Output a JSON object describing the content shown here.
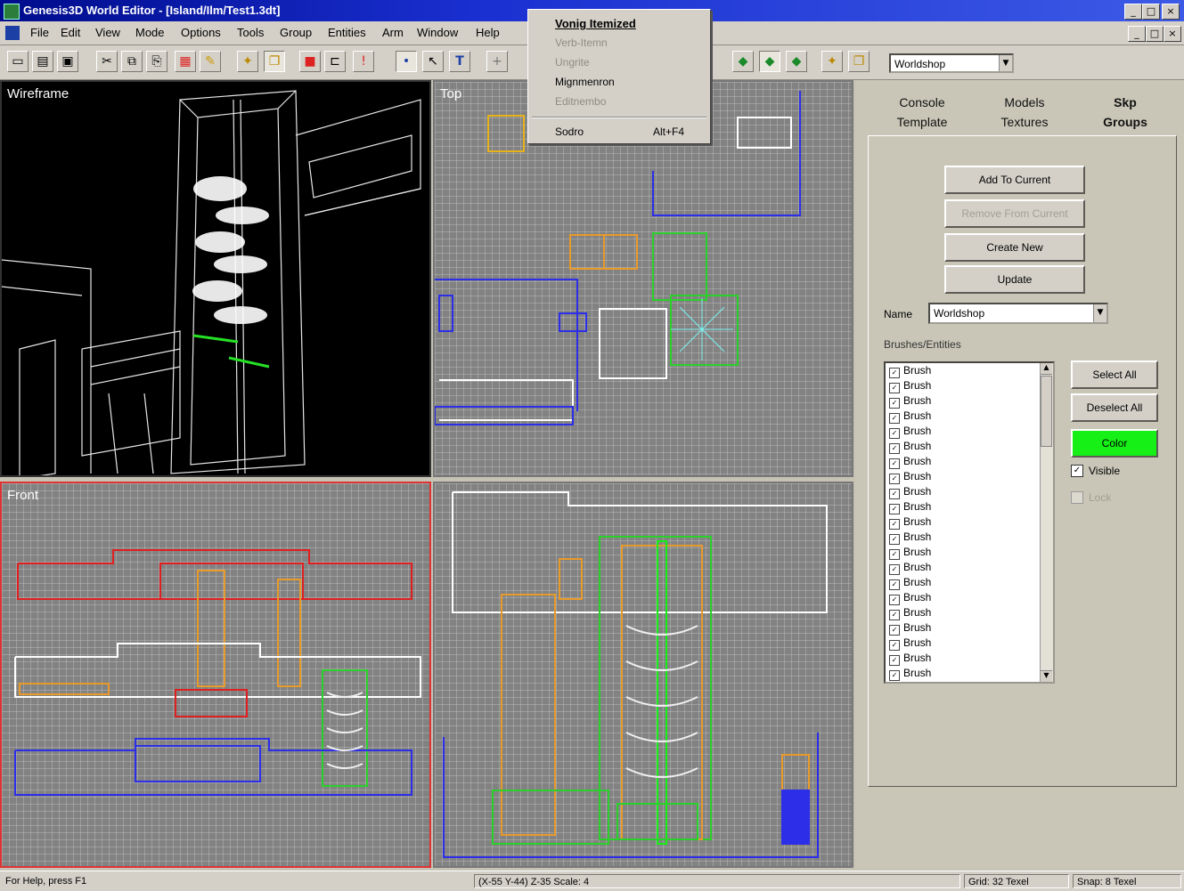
{
  "window": {
    "title": "Genesis3D World Editor - [Island/Ilm/Test1.3dt]"
  },
  "menubar": {
    "items": [
      "File",
      "Edit",
      "View",
      "Mode",
      "Options",
      "Tools",
      "Group",
      "Entities",
      "Arm",
      "Window",
      "Help"
    ]
  },
  "toolbar": {
    "group_combo": "Worldshop"
  },
  "dropdown_menu": {
    "items": [
      "Vonig Itemized",
      "Verb-Itemn",
      "Ungrite",
      "Mignmenron",
      "Editnembo",
      "Sodro"
    ],
    "shortcut": "Alt+F4"
  },
  "viewports": {
    "top_left": "Wireframe",
    "top_right": "Top",
    "bottom_left": "Front",
    "bottom_right": ""
  },
  "tabs": [
    {
      "line1": "Console",
      "line2": "Template"
    },
    {
      "line1": "Models",
      "line2": "Textures"
    },
    {
      "line1": "Skp",
      "line2": "Groups"
    }
  ],
  "panel": {
    "add_button": "Add To Current",
    "remove_button": "Remove From Current",
    "create_button": "Create New",
    "update_button": "Update",
    "name_label": "Name",
    "name_value": "Worldshop",
    "members_label": "Brushes/Entities",
    "members": [
      "Brush",
      "Brush",
      "Brush",
      "Brush",
      "Brush",
      "Brush",
      "Brush",
      "Brush",
      "Brush",
      "Brush",
      "Brush",
      "Brush",
      "Brush",
      "Brush",
      "Brush",
      "Brush",
      "Brush",
      "Brush",
      "Brush",
      "Brush",
      "Brush",
      "Brush"
    ],
    "select_all": "Select All",
    "deselect_all": "Deselect All",
    "color_button": "Color",
    "visible_label": "Visible",
    "visible_checked": true,
    "lock_label": "Lock",
    "lock_checked": false
  },
  "status": {
    "help": "For Help, press F1",
    "coords": "(X-55 Y-44) Z-35  Scale: 4",
    "grid": "Grid: 32 Texel",
    "snap": "Snap: 8 Texel"
  },
  "colors": {
    "accent_green": "#16f016",
    "title_blue": "#0a1a9c",
    "brush_red": "#e02020",
    "brush_blue": "#2c2ee8",
    "brush_orange": "#e89a2a",
    "brush_green": "#2ad12a"
  }
}
